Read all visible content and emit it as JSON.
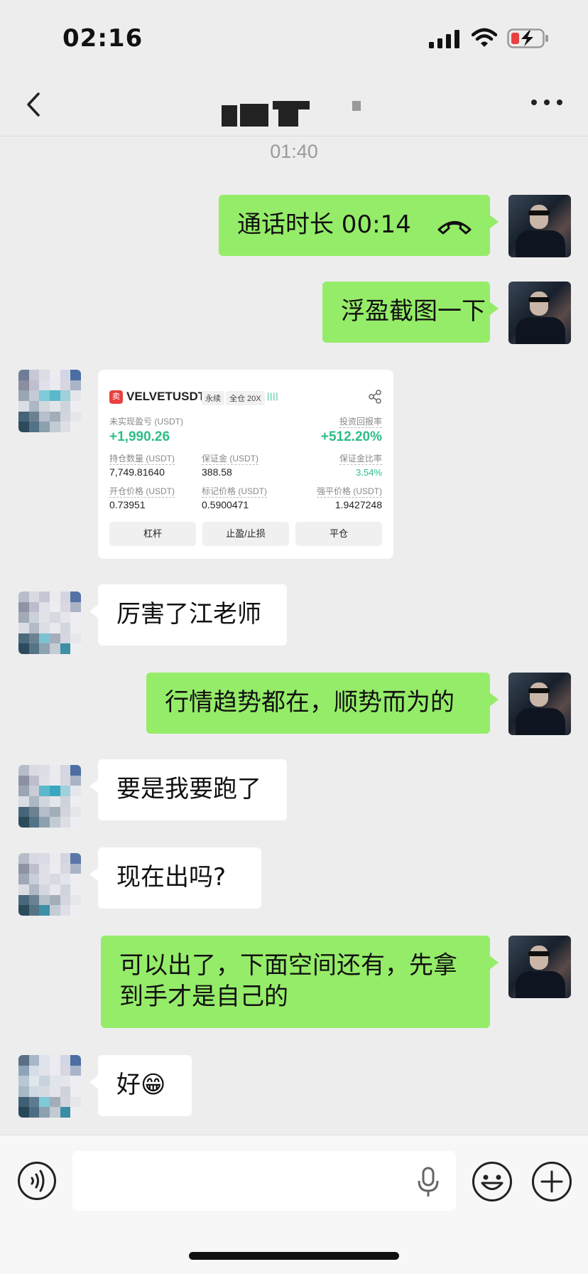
{
  "status_bar": {
    "time": "02:16"
  },
  "header": {
    "back_icon": "chevron-left-icon",
    "more_icon": "more-dots-icon"
  },
  "chat": {
    "timestamp": "01:40",
    "messages": [
      {
        "side": "out",
        "text": "通话时长 00:14",
        "icon": "phone-hangup-icon"
      },
      {
        "side": "out",
        "text": "浮盈截图一下"
      },
      {
        "side": "in",
        "type": "trade-card"
      },
      {
        "side": "in",
        "text": "厉害了江老师"
      },
      {
        "side": "out",
        "text": "行情趋势都在，顺势而为的"
      },
      {
        "side": "in",
        "text": "要是我要跑了"
      },
      {
        "side": "in",
        "text": "现在出吗?"
      },
      {
        "side": "out",
        "text": "可以出了，下面空间还有，先拿到手才是自己的"
      },
      {
        "side": "in",
        "text": "好😁"
      }
    ]
  },
  "trade_card": {
    "logo": "卖",
    "symbol": "VELVETUSDT",
    "tag_perpetual": "永续",
    "tag_margin": "全仓 20X",
    "bars": "||||",
    "unrealized_pnl_label": "未实现盈亏 (USDT)",
    "unrealized_pnl_value": "+1,990.26",
    "roi_label": "投资回报率",
    "roi_value": "+512.20%",
    "position_size_label": "持仓数量 (USDT)",
    "position_size_value": "7,749.81640",
    "margin_label": "保证金 (USDT)",
    "margin_value": "388.58",
    "margin_ratio_label": "保证金比率",
    "margin_ratio_value": "3.54%",
    "entry_price_label": "开仓价格 (USDT)",
    "entry_price_value": "0.73951",
    "mark_price_label": "标记价格 (USDT)",
    "mark_price_value": "0.5900471",
    "liq_price_label": "强平价格 (USDT)",
    "liq_price_value": "1.9427248",
    "btn_leverage": "杠杆",
    "btn_tp_sl": "止盈/止损",
    "btn_close": "平仓"
  },
  "input_bar": {
    "placeholder": "",
    "voice_icon": "voice-icon",
    "mic_icon": "mic-icon",
    "emoji_icon": "emoji-icon",
    "add_icon": "plus-icon"
  },
  "colors": {
    "outgoing_bubble": "#95ec69",
    "incoming_bubble": "#ffffff",
    "background": "#ededed",
    "profit_green": "#2ebd85"
  }
}
